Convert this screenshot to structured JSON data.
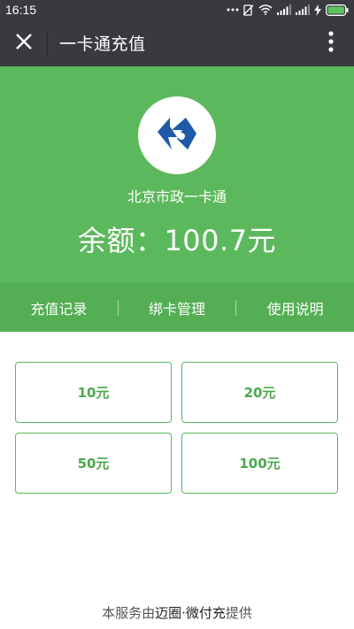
{
  "status_bar": {
    "time": "16:15",
    "icons": [
      "more-dots-icon",
      "mute-icon",
      "wifi-icon",
      "signal-icon",
      "signal-icon",
      "charging-icon",
      "battery-icon"
    ]
  },
  "header": {
    "title": "一卡通充值",
    "close_icon": "close-icon",
    "more_icon": "more-vertical-icon"
  },
  "card": {
    "name": "北京市政一卡通",
    "balance_text": "余额：100.7元"
  },
  "menu": {
    "items": [
      {
        "label": "充值记录"
      },
      {
        "label": "绑卡管理"
      },
      {
        "label": "使用说明"
      }
    ]
  },
  "amounts": [
    {
      "label": "10元"
    },
    {
      "label": "20元"
    },
    {
      "label": "50元"
    },
    {
      "label": "100元"
    }
  ],
  "footer": {
    "prefix": "本服务由",
    "brand": "迈圈·微付充",
    "suffix": "提供"
  },
  "colors": {
    "header_bg": "#393a3f",
    "hero_green": "#5cb85c",
    "menu_green": "#54ae54",
    "button_text": "#4aa84a",
    "logo_blue": "#1f5aa8"
  }
}
